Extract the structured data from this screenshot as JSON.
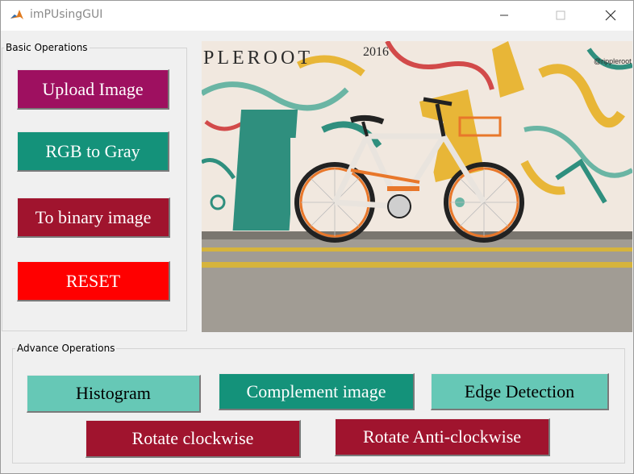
{
  "window": {
    "title": "imPUsingGUI",
    "controls": [
      "minimize-icon",
      "maximize-icon",
      "close-icon"
    ]
  },
  "basic_panel": {
    "title": "Basic Operations",
    "buttons": {
      "upload": {
        "label": "Upload Image",
        "bg": "#9e1060",
        "fg": "#ffffff"
      },
      "rgb_gray": {
        "label": "RGB to Gray",
        "bg": "#14927a",
        "fg": "#ffffff"
      },
      "binary": {
        "label": "To binary image",
        "bg": "#a0142e",
        "fg": "#ffffff"
      },
      "reset": {
        "label": "RESET",
        "bg": "#ff0000",
        "fg": "#ffffff"
      }
    }
  },
  "image_display": {
    "wall_text_left": "PLEROOT",
    "wall_text_right": "2016",
    "wall_tag": "@rippleroot"
  },
  "advance_panel": {
    "title": "Advance Operations",
    "buttons": {
      "histogram": {
        "label": "Histogram",
        "bg": "#66c8b6",
        "fg": "#000000"
      },
      "complement": {
        "label": "Complement image",
        "bg": "#14927a",
        "fg": "#ffffff"
      },
      "edge": {
        "label": "Edge Detection",
        "bg": "#66c8b6",
        "fg": "#000000"
      },
      "rotate_cw": {
        "label": "Rotate clockwise",
        "bg": "#a0142e",
        "fg": "#ffffff"
      },
      "rotate_acw": {
        "label": "Rotate Anti-clockwise",
        "bg": "#a0142e",
        "fg": "#ffffff"
      }
    }
  }
}
